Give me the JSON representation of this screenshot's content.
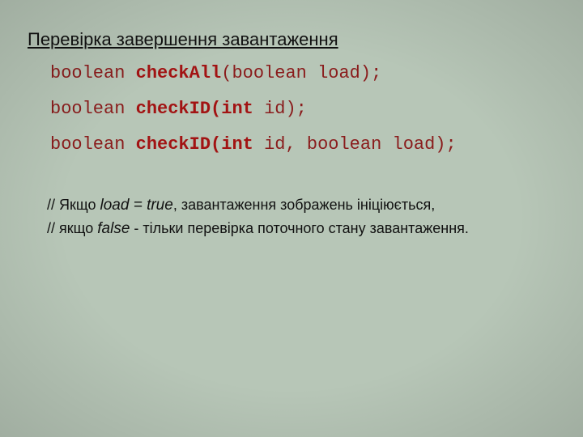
{
  "heading": "Перевірка завершення завантаження",
  "code": {
    "line1": {
      "p1": "boolean ",
      "p2": "checkAll",
      "p3": "(",
      "p4": "boolean load);"
    },
    "line2": {
      "p1": "boolean ",
      "p2": "checkID(int ",
      "p3": "id);"
    },
    "line3": {
      "p1": "boolean ",
      "p2": "checkID(int ",
      "p3": "id, boolean load);"
    }
  },
  "comments": {
    "l1_a": "// Якщо ",
    "l1_b": "load = true",
    "l1_c": ", завантаження зображень ініціюється,",
    "l2_a": "// якщо ",
    "l2_b": "false",
    "l2_c": " - тільки перевірка поточного стану завантаження."
  }
}
